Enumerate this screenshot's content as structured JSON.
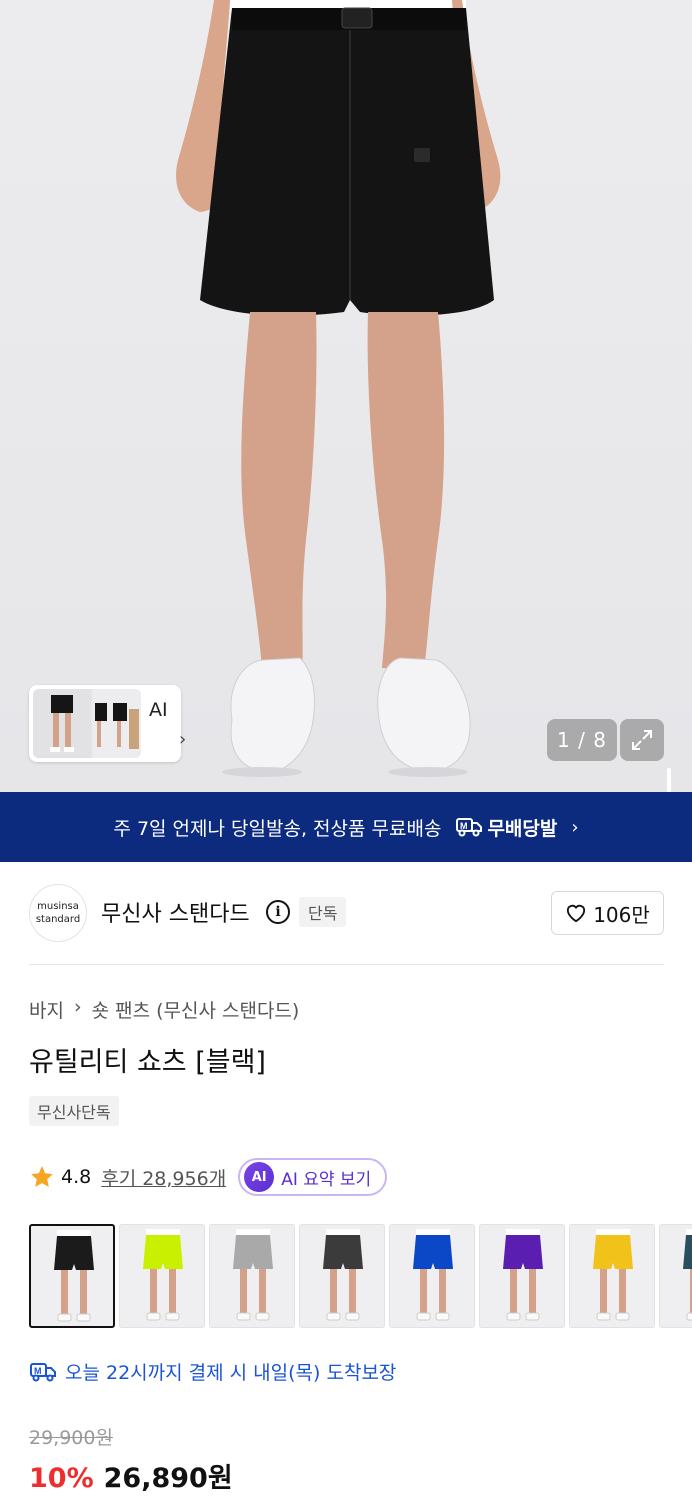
{
  "hero": {
    "thumbnail_label": "AI",
    "counter": "1 / 8"
  },
  "banner": {
    "text": "주 7일 언제나 당일발송, 전상품 무료배송",
    "brand": "무배당발"
  },
  "brand": {
    "logo_line1": "musinsa",
    "logo_line2": "standard",
    "name": "무신사 스탠다드",
    "tag": "단독",
    "likes": "106만"
  },
  "product": {
    "breadcrumb": [
      "바지",
      "숏 팬츠 (무신사 스탠다드)"
    ],
    "title": "유틸리티 쇼츠 [블랙]",
    "tag": "무신사단독",
    "rating": "4.8",
    "reviews": "후기 28,956개",
    "ai_summary": "AI 요약 보기",
    "ai_badge": "AI"
  },
  "swatches": [
    {
      "color": "#1b1b1b"
    },
    {
      "color": "#c8f000"
    },
    {
      "color": "#a9a9a9"
    },
    {
      "color": "#3b3b3b"
    },
    {
      "color": "#0b48c8"
    },
    {
      "color": "#5a1fb0"
    },
    {
      "color": "#f1c21a"
    },
    {
      "color": "#2b4e5e"
    }
  ],
  "delivery": "오늘 22시까지 결제 시 내일(목) 도착보장",
  "price": {
    "original": "29,900원",
    "discount": "10%",
    "final": "26,890원"
  },
  "colors": {
    "banner_bg": "#0d2b7e",
    "accent_blue": "#1a54d6",
    "discount_red": "#ee2d2d",
    "ai_purple": "#5a2ed1"
  }
}
